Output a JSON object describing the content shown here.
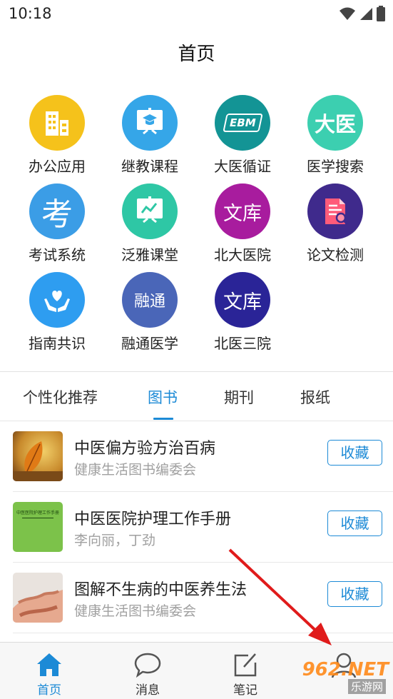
{
  "status_bar": {
    "time": "10:18"
  },
  "header": {
    "title": "首页"
  },
  "apps": [
    {
      "label": "办公应用",
      "icon": "office-building-icon",
      "color": "#f5c21b"
    },
    {
      "label": "继教课程",
      "icon": "presentation-board-icon",
      "color": "#35a6e8"
    },
    {
      "label": "大医循证",
      "icon": "ebm-logo-icon",
      "color": "#139495",
      "glyph": "EBM"
    },
    {
      "label": "医学搜索",
      "icon": "dayi-logo-icon",
      "color": "#3ccfb0",
      "glyph": "大医"
    },
    {
      "label": "考试系统",
      "icon": "exam-kao-icon",
      "color": "#3b9de6",
      "glyph": "考"
    },
    {
      "label": "泛雅课堂",
      "icon": "classroom-chart-icon",
      "color": "#2ec7a5"
    },
    {
      "label": "北大医院",
      "icon": "wenku-library-icon",
      "color": "#a81c9e",
      "glyph": "文库"
    },
    {
      "label": "论文检测",
      "icon": "paper-check-icon",
      "color": "#3f2a8c"
    },
    {
      "label": "指南共识",
      "icon": "hands-heart-icon",
      "color": "#2e9df0"
    },
    {
      "label": "融通医学",
      "icon": "rongtong-icon",
      "color": "#4a66b8",
      "glyph": "融通"
    },
    {
      "label": "北医三院",
      "icon": "wenku-library-icon",
      "color": "#2a2497",
      "glyph": "文库"
    }
  ],
  "tabs": [
    {
      "label": "个性化推荐",
      "active": false
    },
    {
      "label": "图书",
      "active": true
    },
    {
      "label": "期刊",
      "active": false
    },
    {
      "label": "报纸",
      "active": false
    }
  ],
  "books": [
    {
      "title": "中医偏方验方治百病",
      "author": "健康生活图书编委会",
      "action": "收藏",
      "cover": "autumn-leaf-cover"
    },
    {
      "title": "中医医院护理工作手册",
      "author": "李向丽，丁劲",
      "action": "收藏",
      "cover": "green-manual-cover",
      "cover_text": "中医医院护理工作手册"
    },
    {
      "title": "图解不生病的中医养生法",
      "author": "健康生活图书编委会",
      "action": "收藏",
      "cover": "hands-photo-cover"
    }
  ],
  "bottom_nav": [
    {
      "label": "首页",
      "icon": "home-icon",
      "active": true
    },
    {
      "label": "消息",
      "icon": "chat-bubble-icon",
      "active": false
    },
    {
      "label": "笔记",
      "icon": "edit-note-icon",
      "active": false
    },
    {
      "label": "",
      "icon": "profile-icon",
      "active": false
    }
  ],
  "watermark": {
    "text": "962.NET",
    "subtext": "乐游网"
  },
  "colors": {
    "accent": "#1c8ad6",
    "annotation": "#e01b1b"
  }
}
